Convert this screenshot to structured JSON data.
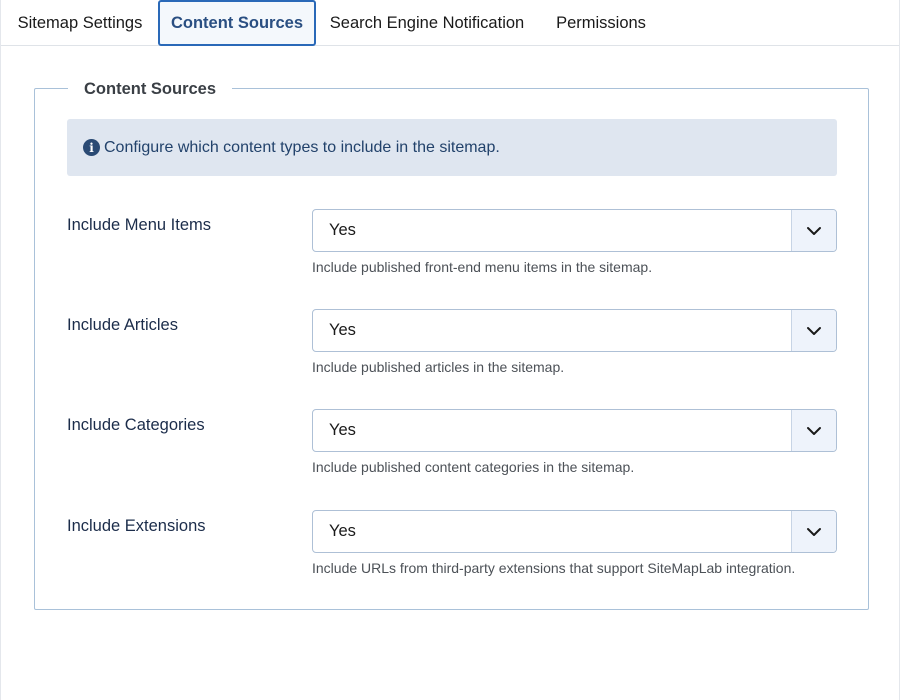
{
  "tabs": [
    {
      "label": "Sitemap Settings",
      "active": false
    },
    {
      "label": "Content Sources",
      "active": true
    },
    {
      "label": "Search Engine Notification",
      "active": false
    },
    {
      "label": "Permissions",
      "active": false
    }
  ],
  "fieldset": {
    "legend": "Content Sources",
    "info_icon": "info-circle-icon",
    "info_text": "Configure which content types to include in the sitemap."
  },
  "fields": [
    {
      "label": "Include Menu Items",
      "value": "Yes",
      "description": "Include published front-end menu items in the sitemap."
    },
    {
      "label": "Include Articles",
      "value": "Yes",
      "description": "Include published articles in the sitemap."
    },
    {
      "label": "Include Categories",
      "value": "Yes",
      "description": "Include published content categories in the sitemap."
    },
    {
      "label": "Include Extensions",
      "value": "Yes",
      "description": "Include URLs from third-party extensions that support SiteMapLab integration."
    }
  ],
  "colors": {
    "accent": "#2a69b8",
    "alert_bg": "#dfe6f0",
    "border": "#a9c1d9"
  }
}
